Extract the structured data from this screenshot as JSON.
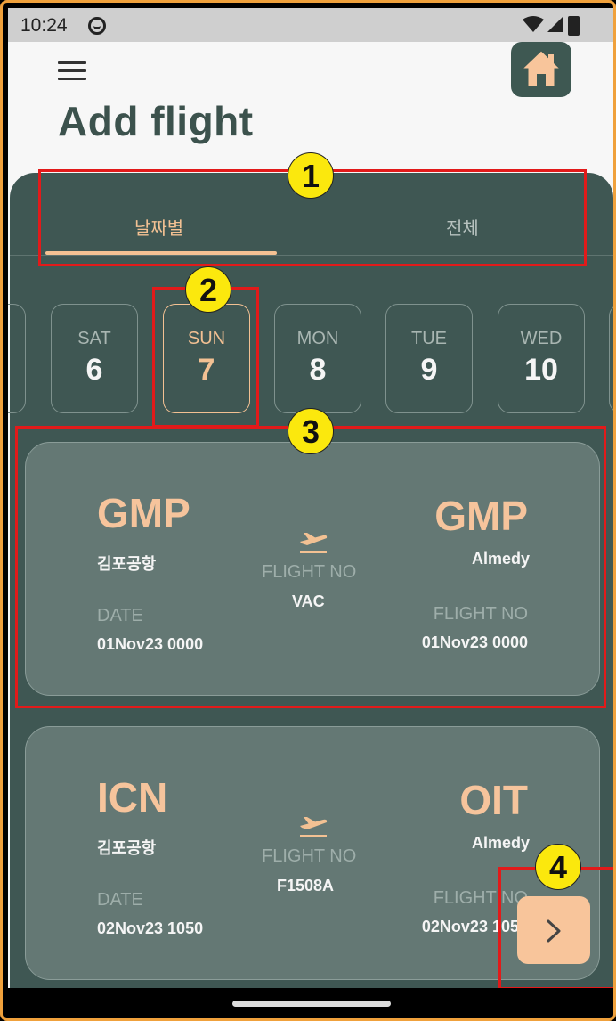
{
  "status_bar": {
    "time": "10:24"
  },
  "header": {
    "title": "Add flight"
  },
  "tabs": [
    {
      "label": "날짜별",
      "active": true
    },
    {
      "label": "전체",
      "active": false
    }
  ],
  "days": [
    {
      "dow": "",
      "num": ""
    },
    {
      "dow": "SAT",
      "num": "6"
    },
    {
      "dow": "SUN",
      "num": "7",
      "selected": true
    },
    {
      "dow": "MON",
      "num": "8"
    },
    {
      "dow": "TUE",
      "num": "9"
    },
    {
      "dow": "WED",
      "num": "10"
    },
    {
      "dow": "",
      "num": ""
    }
  ],
  "flights": [
    {
      "from_code": "GMP",
      "from_name": "김포공항",
      "to_code": "GMP",
      "to_name": "Almedy",
      "center_label": "FLIGHT NO",
      "center_value": "VAC",
      "left_label": "DATE",
      "left_value": "01Nov23 0000",
      "right_label": "FLIGHT NO",
      "right_value": "01Nov23 0000"
    },
    {
      "from_code": "ICN",
      "from_name": "김포공항",
      "to_code": "OIT",
      "to_name": "Almedy",
      "center_label": "FLIGHT NO",
      "center_value": "F1508A",
      "left_label": "DATE",
      "left_value": "02Nov23 1050",
      "right_label": "FLIGHT NO",
      "right_value": "02Nov23 1050"
    }
  ],
  "annotations": [
    "1",
    "2",
    "3",
    "4"
  ],
  "colors": {
    "panel": "#3f5753",
    "card": "#647874",
    "accent": "#f3c193",
    "annotation_box": "#e21a1a",
    "annotation_badge": "#fbe80d"
  },
  "icons": {
    "menu": "hamburger-icon",
    "home": "home-icon",
    "plane": "plane-departure-icon",
    "next": "chevron-right-icon"
  }
}
